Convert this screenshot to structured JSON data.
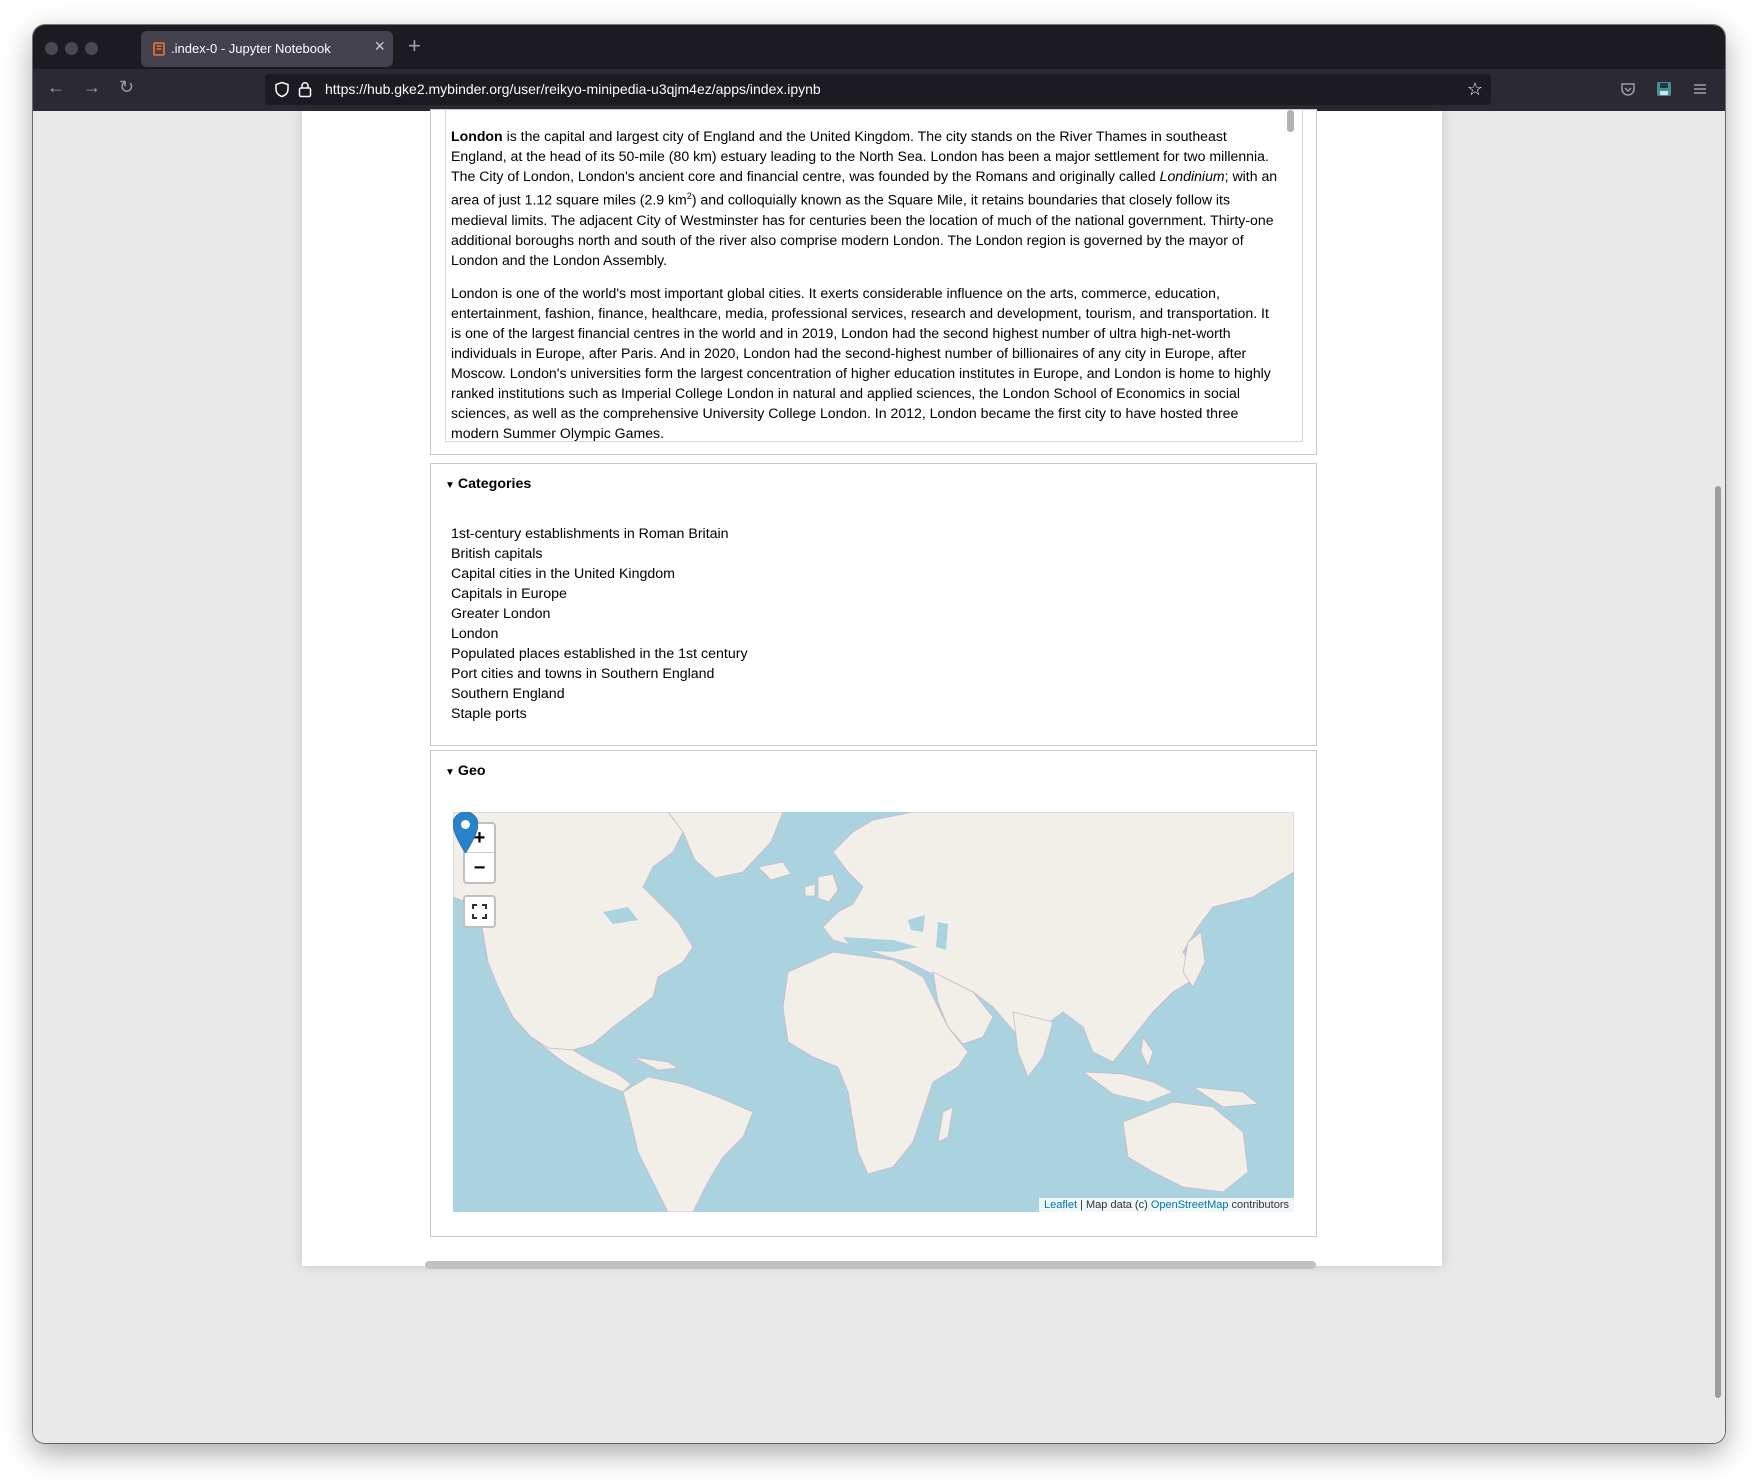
{
  "browser": {
    "tab_title": ".index-0 - Jupyter Notebook",
    "url": "https://hub.gke2.mybinder.org/user/reikyo-minipedia-u3qjm4ez/apps/index.ipynb"
  },
  "intro": {
    "p1_bold": "London",
    "p1_a": " is the capital and largest city of England and the United Kingdom. The city stands on the River Thames in southeast England, at the head of its 50-mile (80 km) estuary leading to the North Sea. London has been a major settlement for two millennia. The City of London, London's ancient core and financial centre, was founded by the Romans and originally called ",
    "p1_italic": "Londinium",
    "p1_b": "; with an area of just 1.12 square miles (2.9 km",
    "p1_sup": "2",
    "p1_c": ") and colloquially known as the Square Mile, it retains boundaries that closely follow its medieval limits. The adjacent City of Westminster has for centuries been the location of much of the national government. Thirty-one additional boroughs north and south of the river also comprise modern London. The London region is governed by the mayor of London and the London Assembly.",
    "p2": "London is one of the world's most important global cities. It exerts considerable influence on the arts, commerce, education, entertainment, fashion, finance, healthcare, media, professional services, research and development, tourism, and transportation. It is one of the largest financial centres in the world and in 2019, London had the second highest number of ultra high-net-worth individuals in Europe, after Paris. And in 2020, London had the second-highest number of billionaires of any city in Europe, after Moscow. London's universities form the largest concentration of higher education institutes in Europe, and London is home to highly ranked institutions such as Imperial College London in natural and applied sciences, the London School of Economics in social sciences, as well as the comprehensive University College London. In 2012, London became the first city to have hosted three modern Summer Olympic Games."
  },
  "categories": {
    "title": "Categories",
    "items": [
      "1st-century establishments in Roman Britain",
      "British capitals",
      "Capital cities in the United Kingdom",
      "Capitals in Europe",
      "Greater London",
      "London",
      "Populated places established in the 1st century",
      "Port cities and towns in Southern England",
      "Southern England",
      "Staple ports"
    ]
  },
  "geo": {
    "title": "Geo",
    "zoom_in": "+",
    "zoom_out": "−",
    "attribution_leaflet": "Leaflet",
    "attribution_mid": " | Map data (c) ",
    "attribution_osm": "OpenStreetMap",
    "attribution_end": " contributors"
  },
  "colors": {
    "ocean": "#aad3df",
    "land": "#f2efe9",
    "marker": "#2a81cb"
  }
}
